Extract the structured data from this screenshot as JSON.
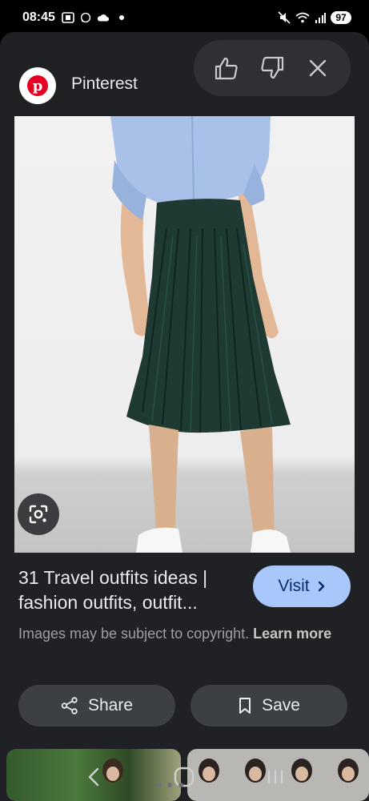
{
  "status_bar": {
    "time": "08:45",
    "battery": "97",
    "left_icons": [
      "screenshot-icon",
      "whatsapp-icon",
      "cloud-icon",
      "notification-dot"
    ],
    "right_icons": [
      "mute-icon",
      "wifi-icon",
      "signal-icon"
    ]
  },
  "header": {
    "source_name": "Pinterest",
    "source_logo_letter": "p",
    "feedback_icons": [
      "thumbs-up-icon",
      "thumbs-down-icon",
      "close-icon"
    ]
  },
  "image": {
    "description_icon": "google-lens-icon"
  },
  "result": {
    "title": "31 Travel outfits ideas | fashion outfits, outfit...",
    "visit_label": "Visit",
    "copyright_text": "Images may be subject to copyright.",
    "learn_more_label": "Learn more"
  },
  "actions": {
    "share_label": "Share",
    "save_label": "Save"
  },
  "colors": {
    "sheet_bg": "#1f2124",
    "visit_bg": "#a8c7fa",
    "visit_text": "#062e6f",
    "action_bg": "#3c4043",
    "pinterest_red": "#e60023"
  }
}
